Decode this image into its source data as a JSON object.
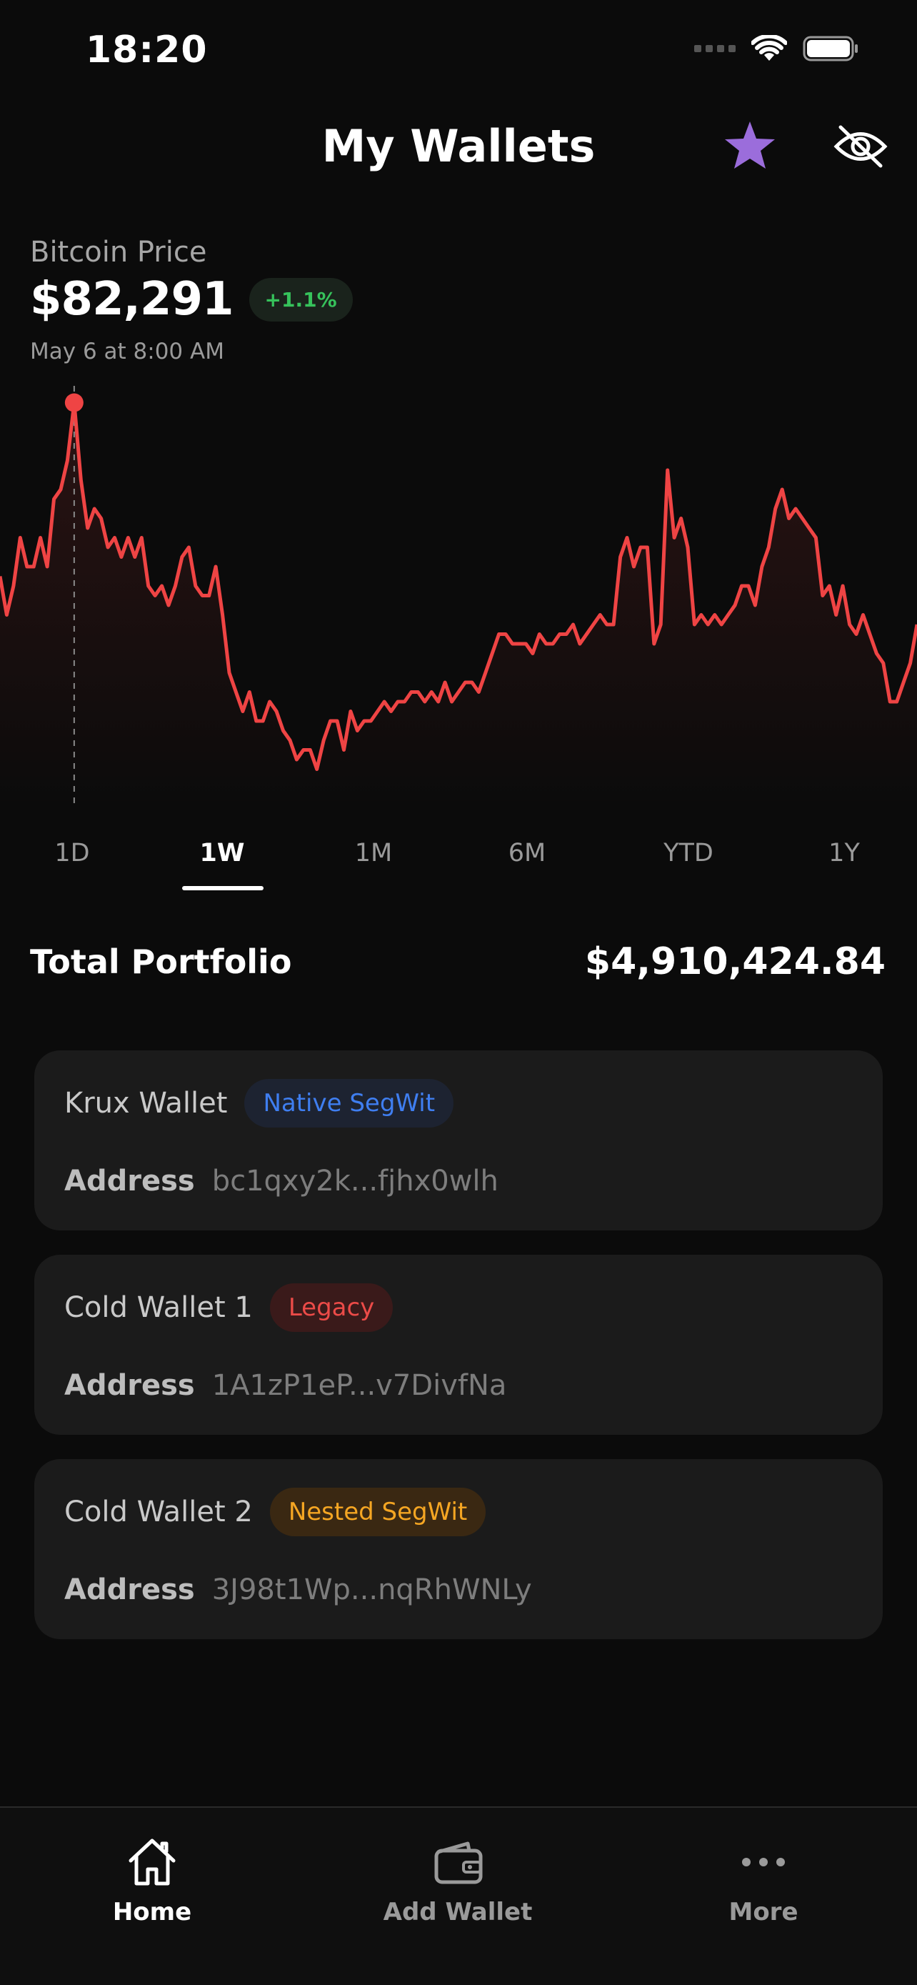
{
  "status_bar": {
    "time": "18:20"
  },
  "header": {
    "title": "My Wallets"
  },
  "icons": {
    "star": "star-icon",
    "hide": "eye-off-icon",
    "home": "home-icon",
    "wallet": "wallet-icon",
    "more": "more-icon"
  },
  "colors": {
    "accent": "#9b6ddb",
    "chart_line": "#ef4444",
    "positive": "#36c25b",
    "background": "#0b0b0b"
  },
  "price": {
    "label": "Bitcoin Price",
    "value": "$82,291",
    "change": "+1.1%",
    "date": "May 6 at 8:00 AM"
  },
  "chart_data": {
    "type": "line",
    "series": [
      {
        "values": [
          82100,
          81700,
          82000,
          82500,
          82200,
          82200,
          82500,
          82200,
          82900,
          83000,
          83300,
          83900,
          83100,
          82600,
          82800,
          82700,
          82400,
          82500,
          82300,
          82500,
          82300,
          82500,
          82000,
          81900,
          82000,
          81800,
          82000,
          82300,
          82400,
          82000,
          81900,
          81900,
          82200,
          81700,
          81100,
          80900,
          80700,
          80900,
          80600,
          80600,
          80800,
          80700,
          80500,
          80400,
          80200,
          80300,
          80300,
          80100,
          80400,
          80600,
          80600,
          80300,
          80700,
          80500,
          80600,
          80600,
          80700,
          80800,
          80700,
          80800,
          80800,
          80900,
          80900,
          80800,
          80900,
          80800,
          81000,
          80800,
          80900,
          81000,
          81000,
          80900,
          81100,
          81300,
          81500,
          81500,
          81400,
          81400,
          81400,
          81300,
          81500,
          81400,
          81400,
          81500,
          81500,
          81600,
          81400,
          81500,
          81600,
          81700,
          81600,
          81600,
          82300,
          82500,
          82200,
          82400,
          82400,
          81400,
          81600,
          83200,
          82500,
          82700,
          82400,
          81600,
          81700,
          81600,
          81700,
          81600,
          81700,
          81800,
          82000,
          82000,
          81800,
          82200,
          82400,
          82800,
          83000,
          82700,
          82800,
          82700,
          82600,
          82500,
          81900,
          82000,
          81700,
          82000,
          81600,
          81500,
          81700,
          81500,
          81300,
          81200,
          80800,
          80800,
          81000,
          81200,
          81600
        ]
      }
    ],
    "selected_point_index": 11,
    "ylim": [
      80000,
      84000
    ],
    "periods": [
      "1D",
      "1W",
      "1M",
      "6M",
      "YTD",
      "1Y"
    ],
    "active_period": "1W",
    "grid": false
  },
  "portfolio": {
    "label": "Total Portfolio",
    "value": "$4,910,424.84"
  },
  "wallets": [
    {
      "name": "Krux Wallet",
      "type": "Native SegWit",
      "address_label": "Address",
      "address": "bc1qxy2k...fjhx0wlh"
    },
    {
      "name": "Cold Wallet 1",
      "type": "Legacy",
      "address_label": "Address",
      "address": "1A1zP1eP...v7DivfNa"
    },
    {
      "name": "Cold Wallet 2",
      "type": "Nested SegWit",
      "address_label": "Address",
      "address": "3J98t1Wp...nqRhWNLy"
    }
  ],
  "tabbar": {
    "home": "Home",
    "add_wallet": "Add Wallet",
    "more": "More"
  }
}
